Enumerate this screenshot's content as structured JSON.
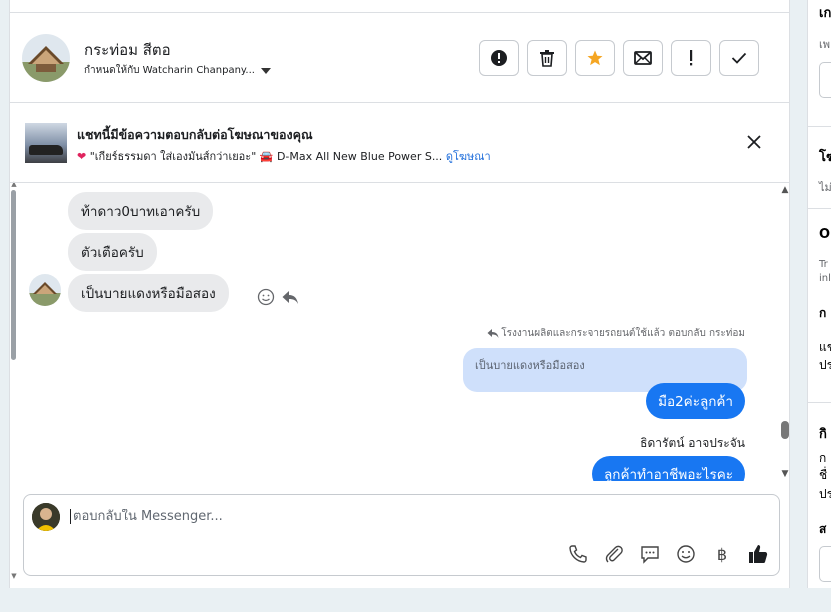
{
  "contact": {
    "name": "กระท่อม สีตอ",
    "assigned_to": "กำหนดให้กับ Watcharin Chanpany..."
  },
  "toolbar": {
    "buttons": [
      {
        "name": "alert-icon",
        "glyph": "!"
      },
      {
        "name": "trash-icon",
        "glyph": ""
      },
      {
        "name": "star-icon",
        "glyph": "★"
      },
      {
        "name": "mail-icon",
        "glyph": ""
      },
      {
        "name": "exclamation-icon",
        "glyph": "!"
      },
      {
        "name": "check-icon",
        "glyph": "✓"
      }
    ]
  },
  "ad_banner": {
    "title": "แชทนี้มีข้อความตอบกลับต่อโฆษณาของคุณ",
    "subtitle": "\"เกียร์ธรรมดา ใส่เองมันส์กว่าเยอะ\" 🚘 D-Max All New Blue Power S...",
    "link": "ดูโฆษณา"
  },
  "messages": {
    "incoming": [
      "ท้าดาว0บาทเอาครับ",
      "ตัวเตือครับ",
      "เป็นบายแดงหรือมือสอง"
    ],
    "reply_meta": "โรงงานผลิตและกระจายรถยนต์ใช้แล้ว ตอบกลับ กระท่อม",
    "quoted": "เป็นบายแดงหรือมือสอง",
    "outgoing_1": "มือ2ค่ะลูกค้า",
    "sender": "ธิดารัตน์ อาจประจัน",
    "outgoing_2": "ลูกค้าทำอาชีพอะไรคะ"
  },
  "composer": {
    "placeholder": "ตอบกลับใน Messenger..."
  },
  "right_panel": {
    "texts": [
      "เก",
      "เพ",
      "โฆ",
      "ไม่",
      "O",
      "Tr",
      "inl",
      "ก",
      "แช",
      "ปร",
      "กิ",
      "ก",
      "ชื่",
      "ปร",
      "ส"
    ]
  },
  "colors": {
    "accent": "#1877f2",
    "star": "#f5a623",
    "quoted_bg": "#cfe0fb",
    "link": "#216fdb"
  }
}
